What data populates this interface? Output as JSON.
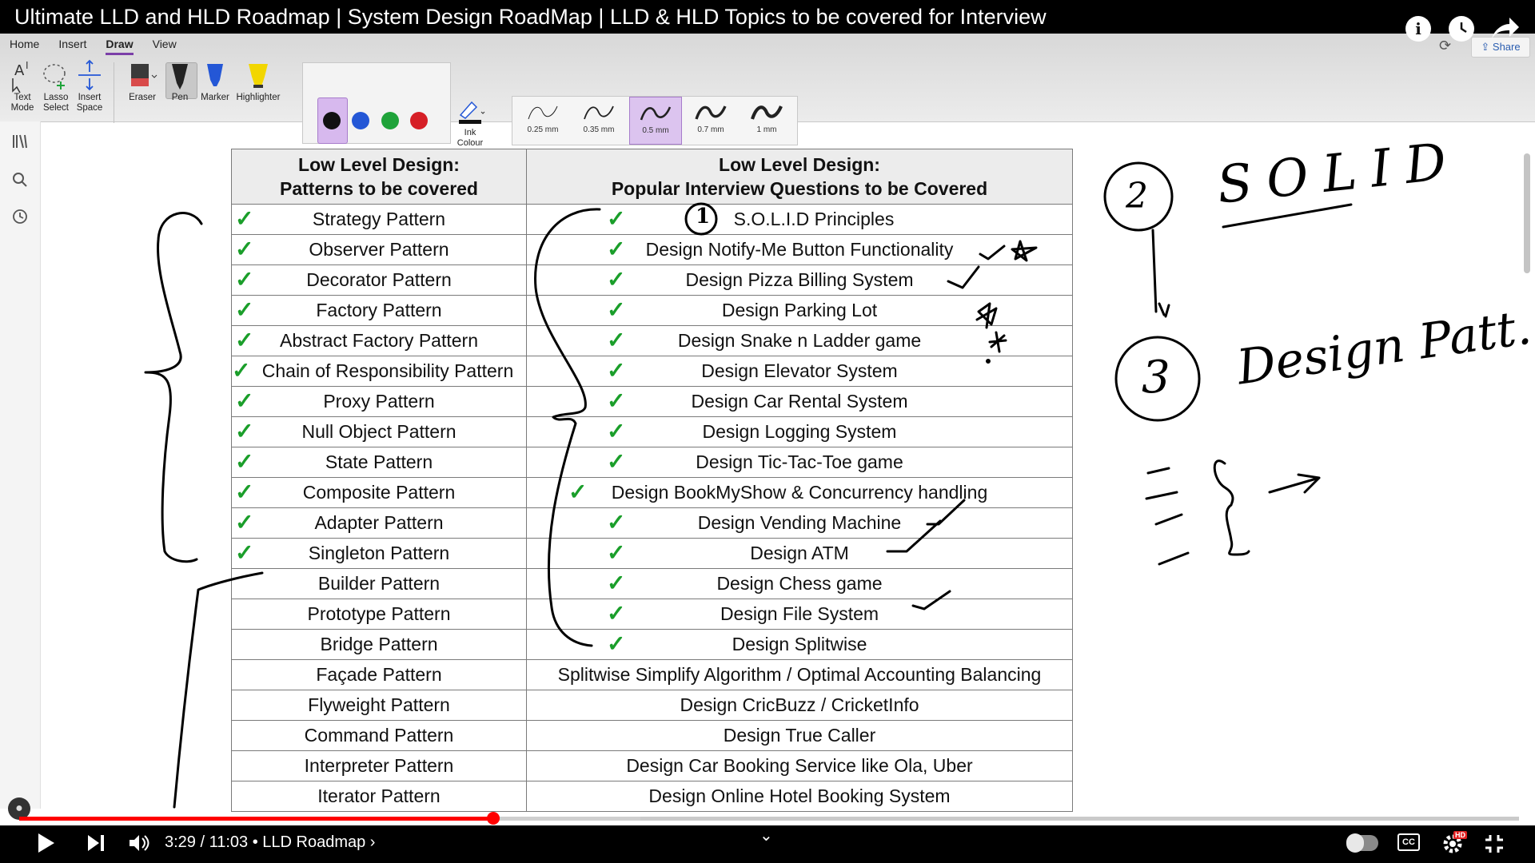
{
  "video": {
    "title": "Ultimate LLD and HLD Roadmap | System Design RoadMap | LLD & HLD Topics to be covered for Interview",
    "time": "3:29 / 11:03 • LLD Roadmap ›",
    "progress": 0.316,
    "buffered": 0.414
  },
  "onenote": {
    "tabs": [
      "Home",
      "Insert",
      "Draw",
      "View"
    ],
    "active_tab": "Draw",
    "share_label": "Share",
    "tools": {
      "text_mode": "Text\nMode",
      "lasso": "Lasso\nSelect",
      "insert_space": "Insert\nSpace",
      "eraser": "Eraser",
      "pen": "Pen",
      "marker": "Marker",
      "highlighter": "Highlighter",
      "ink_colour": "Ink\nColour"
    },
    "colours": [
      "#111111",
      "#2457d6",
      "#1fa33a",
      "#d61f26"
    ],
    "selected_colour": "#111111",
    "thickness": [
      "0.25 mm",
      "0.35 mm",
      "0.5 mm",
      "0.7 mm",
      "1 mm"
    ],
    "selected_thickness": "0.5 mm"
  },
  "table": {
    "header_left_1": "Low Level Design:",
    "header_left_2": "Patterns to be covered",
    "header_right_1": "Low Level Design:",
    "header_right_2": "Popular Interview Questions to be Covered",
    "patterns": [
      "Strategy Pattern",
      "Observer Pattern",
      "Decorator Pattern",
      "Factory Pattern",
      "Abstract Factory Pattern",
      "Chain of Responsibility Pattern",
      "Proxy Pattern",
      "Null Object Pattern",
      "State Pattern",
      "Composite Pattern",
      "Adapter Pattern",
      "Singleton Pattern",
      "Builder Pattern",
      "Prototype Pattern",
      "Bridge Pattern",
      "Façade Pattern",
      "Flyweight Pattern",
      "Command Pattern",
      "Interpreter Pattern",
      "Iterator Pattern"
    ],
    "questions": [
      "S.O.L.I.D Principles",
      "Design Notify-Me Button Functionality",
      "Design  Pizza Billing System",
      "Design  Parking Lot",
      "Design  Snake n Ladder game",
      "Design Elevator System",
      "Design Car Rental System",
      "Design Logging System",
      "Design Tic-Tac-Toe game",
      "Design BookMyShow & Concurrency handling",
      "Design Vending Machine",
      "Design ATM",
      "Design Chess game",
      "Design File System",
      "Design Splitwise",
      "Splitwise Simplify Algorithm / Optimal Accounting Balancing",
      "Design CricBuzz / CricketInfo",
      "Design True Caller",
      "Design Car Booking Service like Ola, Uber",
      "Design Online Hotel Booking System"
    ],
    "patterns_checked": 12,
    "questions_checked": 15
  },
  "handwriting": {
    "circle_1": "1",
    "circle_2": "2",
    "circle_3": "3",
    "solid": "SOLID",
    "design_pattern": "Design Patt."
  }
}
